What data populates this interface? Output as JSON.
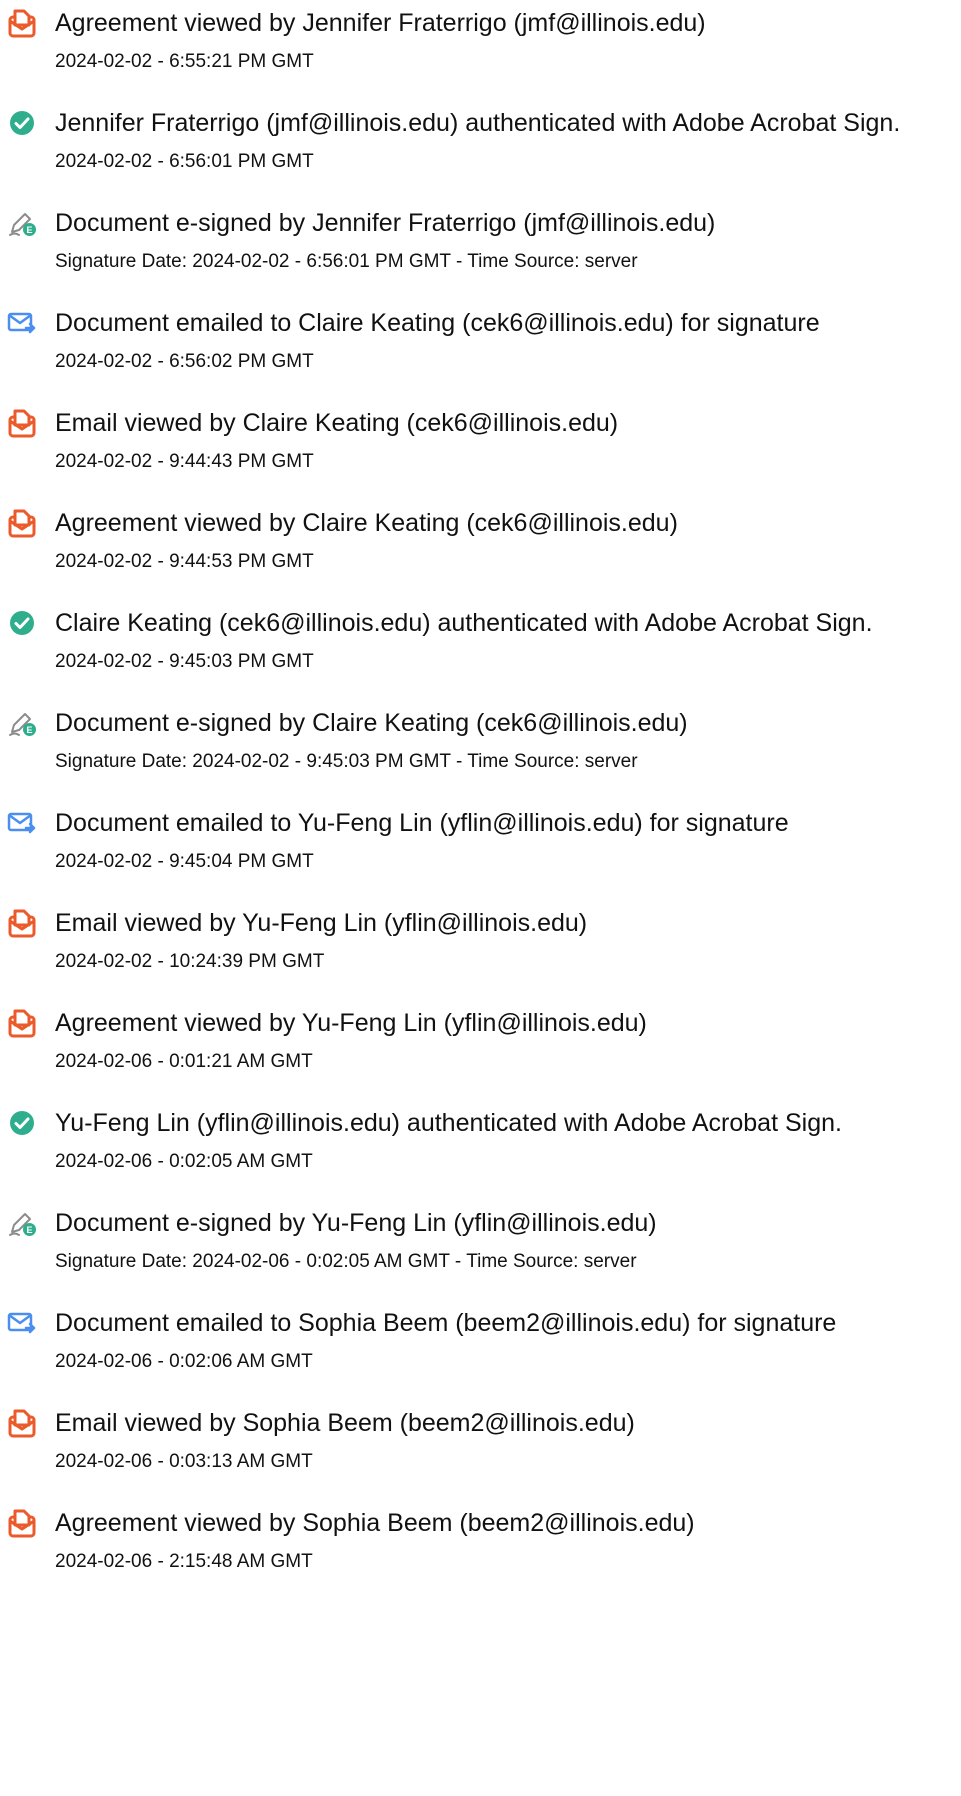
{
  "colors": {
    "viewed_icon": "#ea5a2a",
    "authenticated_icon": "#2fae8e",
    "signed_icon": "#2fae8e",
    "emailed_icon": "#4a8ff0",
    "text": "#111111"
  },
  "entries": [
    {
      "icon": "document-viewed-icon",
      "title": "Agreement viewed by Jennifer Fraterrigo (jmf@illinois.edu)",
      "sub": "2024-02-02 - 6:55:21 PM GMT"
    },
    {
      "icon": "check-circle-icon",
      "title": "Jennifer Fraterrigo (jmf@illinois.edu) authenticated with Adobe Acrobat Sign.",
      "sub": "2024-02-02 - 6:56:01 PM GMT"
    },
    {
      "icon": "esign-pen-icon",
      "title": "Document e-signed by Jennifer Fraterrigo (jmf@illinois.edu)",
      "sub": "Signature Date: 2024-02-02 - 6:56:01 PM GMT - Time Source: server"
    },
    {
      "icon": "email-sent-icon",
      "title": "Document emailed to Claire Keating (cek6@illinois.edu) for signature",
      "sub": "2024-02-02 - 6:56:02 PM GMT"
    },
    {
      "icon": "document-viewed-icon",
      "title": "Email viewed by Claire Keating (cek6@illinois.edu)",
      "sub": "2024-02-02 - 9:44:43 PM GMT"
    },
    {
      "icon": "document-viewed-icon",
      "title": "Agreement viewed by Claire Keating (cek6@illinois.edu)",
      "sub": "2024-02-02 - 9:44:53 PM GMT"
    },
    {
      "icon": "check-circle-icon",
      "title": "Claire Keating (cek6@illinois.edu) authenticated with Adobe Acrobat Sign.",
      "sub": "2024-02-02 - 9:45:03 PM GMT"
    },
    {
      "icon": "esign-pen-icon",
      "title": "Document e-signed by Claire Keating (cek6@illinois.edu)",
      "sub": "Signature Date: 2024-02-02 - 9:45:03 PM GMT - Time Source: server"
    },
    {
      "icon": "email-sent-icon",
      "title": "Document emailed to Yu-Feng Lin (yflin@illinois.edu) for signature",
      "sub": "2024-02-02 - 9:45:04 PM GMT"
    },
    {
      "icon": "document-viewed-icon",
      "title": "Email viewed by Yu-Feng Lin (yflin@illinois.edu)",
      "sub": "2024-02-02 - 10:24:39 PM GMT"
    },
    {
      "icon": "document-viewed-icon",
      "title": "Agreement viewed by Yu-Feng Lin (yflin@illinois.edu)",
      "sub": "2024-02-06 - 0:01:21 AM GMT"
    },
    {
      "icon": "check-circle-icon",
      "title": "Yu-Feng Lin (yflin@illinois.edu) authenticated with Adobe Acrobat Sign.",
      "sub": "2024-02-06 - 0:02:05 AM GMT"
    },
    {
      "icon": "esign-pen-icon",
      "title": "Document e-signed by Yu-Feng Lin (yflin@illinois.edu)",
      "sub": "Signature Date: 2024-02-06 - 0:02:05 AM GMT - Time Source: server"
    },
    {
      "icon": "email-sent-icon",
      "title": "Document emailed to Sophia Beem (beem2@illinois.edu) for signature",
      "sub": "2024-02-06 - 0:02:06 AM GMT"
    },
    {
      "icon": "document-viewed-icon",
      "title": "Email viewed by Sophia Beem (beem2@illinois.edu)",
      "sub": "2024-02-06 - 0:03:13 AM GMT"
    },
    {
      "icon": "document-viewed-icon",
      "title": "Agreement viewed by Sophia Beem (beem2@illinois.edu)",
      "sub": "2024-02-06 - 2:15:48 AM GMT"
    }
  ]
}
